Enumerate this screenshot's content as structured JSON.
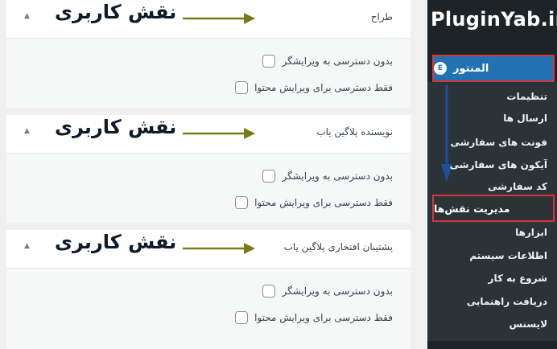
{
  "brand": "PluginYab.ir",
  "colors": {
    "sidebar_bg": "#1d2327",
    "submenu_bg": "#2c3338",
    "active_bg": "#2271b1",
    "highlight_border": "#d63638",
    "annotation_arrow": "#7a7a17",
    "annotation_text": "#0d1b2a",
    "blue_arrow": "#1f4e9a"
  },
  "sidebar": {
    "top_item": {
      "label": "المنتور",
      "icon": "elementor-icon"
    },
    "items": [
      {
        "label": "تنظیمات"
      },
      {
        "label": "ارسال ها"
      },
      {
        "label": "فونت های سفارشی"
      },
      {
        "label": "آیکون های سفارشی"
      },
      {
        "label": "کد سفارشی"
      },
      {
        "label": "مدیریت نقش‌ها"
      },
      {
        "label": "ابزارها"
      },
      {
        "label": "اطلاعات سیستم"
      },
      {
        "label": "شروع به کار"
      },
      {
        "label": "دریافت راهنمایی"
      },
      {
        "label": "لایسنس"
      }
    ]
  },
  "annotation_label": "نقش کاربری",
  "roles": [
    {
      "title": "طراح",
      "options": [
        "بدون دسترسی به ویرایشگر",
        "فقط دسترسی برای ویرایش محتوا"
      ]
    },
    {
      "title": "نویسنده پلاگین یاب",
      "options": [
        "بدون دسترسی به ویرایشگر",
        "فقط دسترسی برای ویرایش محتوا"
      ]
    },
    {
      "title": "پشتیبان افتخاری پلاگین یاب",
      "options": [
        "بدون دسترسی به ویرایشگر",
        "فقط دسترسی برای ویرایش محتوا"
      ]
    }
  ]
}
